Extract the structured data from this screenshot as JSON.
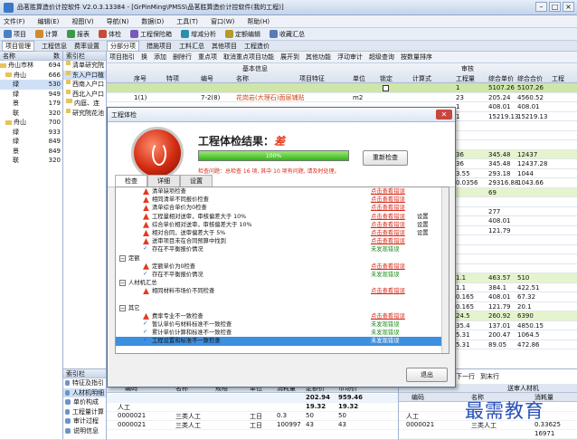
{
  "window": {
    "title": "品茗胜算造价计控软件 V2.0.3.13384 - [GrPinMing\\PMSS\\品茗胜算造价计控软件(我的工程)]"
  },
  "menu": [
    "文件(F)",
    "编辑(E)",
    "视图(V)",
    "导航(N)",
    "数据(D)",
    "工具(T)",
    "窗口(W)",
    "帮助(H)"
  ],
  "toolbar": [
    "项目",
    "计算",
    "报表",
    "体检",
    "工程保险箱",
    "增减分析",
    "定额编辑",
    "收藏汇总"
  ],
  "tabs": [
    "项目管理",
    "工程信息",
    "费率设置",
    "分部分项",
    "措施项目",
    "工料汇总",
    "其他项目",
    "工程造价"
  ],
  "left_tree": {
    "header": [
      "名称",
      "数"
    ],
    "rows": [
      {
        "label": "舟山市林",
        "val": "694"
      },
      {
        "label": "舟山",
        "val": "666"
      },
      {
        "label": "绿",
        "val": "530"
      },
      {
        "label": "绿",
        "val": "949"
      },
      {
        "label": "景",
        "val": "179"
      },
      {
        "label": "联",
        "val": "320"
      },
      {
        "label": "舟山",
        "val": "700"
      },
      {
        "label": "绿",
        "val": "933"
      },
      {
        "label": "绿",
        "val": "849"
      },
      {
        "label": "景",
        "val": "849"
      },
      {
        "label": "联",
        "val": "320"
      }
    ]
  },
  "nav_tree": {
    "header": "索引栏",
    "rows": [
      "清单研究院",
      "东入户口植",
      "西南入户口",
      "西北入户口",
      "内庭、连",
      "研究院花池"
    ]
  },
  "cmdbar": [
    "项目指引",
    "换",
    "添加",
    "删除行",
    "重点项",
    "取消重点项目功能",
    "展开到",
    "其他功能",
    "浮动审计",
    "超级查询",
    "按数量排序"
  ],
  "grid": {
    "header_top": [
      "基本信息",
      "审核"
    ],
    "columns": [
      "序号",
      "特项",
      "编号",
      "名称",
      "项目特征",
      "单位",
      "锁定",
      "计算式",
      "工程量",
      "综合单价",
      "综合合价",
      "工程"
    ],
    "rows": [
      {
        "a": "",
        "b": "",
        "c": "",
        "d": "",
        "e": "",
        "f": "",
        "g": "",
        "h": "",
        "q": "1",
        "p": "5107.26",
        "t": "5107.26",
        "hl": true
      },
      {
        "a": "1(1)",
        "b": "",
        "c": "7-2(8)",
        "d": "花岗岩(大理石)面层铺贴",
        "e": "",
        "f": "m2",
        "g": "",
        "h": "",
        "q": "23",
        "p": "205.24",
        "t": "4560.52",
        "hl": false
      },
      {
        "a": "",
        "b": "",
        "c": "",
        "d": "",
        "e": "",
        "f": "",
        "g": "",
        "h": "",
        "q": "1",
        "p": "408.01",
        "t": "408.01",
        "hl": false
      },
      {
        "a": "",
        "b": "",
        "c": "",
        "d": "",
        "e": "",
        "f": "",
        "g": "",
        "h": "",
        "q": "1",
        "p": "15219.13",
        "t": "15219.13",
        "hl": false
      },
      {
        "a": "",
        "b": "",
        "c": "",
        "d": "",
        "e": "",
        "f": "",
        "g": "",
        "h": "",
        "q": "",
        "p": "",
        "t": "",
        "hl": false
      },
      {
        "a": "",
        "b": "",
        "c": "",
        "d": "",
        "e": "",
        "f": "",
        "g": "",
        "h": "",
        "q": "",
        "p": "",
        "t": "",
        "hl": false
      },
      {
        "a": "",
        "b": "",
        "c": "",
        "d": "",
        "e": "",
        "f": "",
        "g": "",
        "h": "",
        "q": "",
        "p": "",
        "t": "",
        "hl": false
      },
      {
        "a": "",
        "b": "",
        "c": "",
        "d": "",
        "e": "",
        "f": "",
        "g": "",
        "h": "",
        "q": "36",
        "p": "345.48",
        "t": "12437",
        "hl": true
      },
      {
        "a": "",
        "b": "",
        "c": "",
        "d": "",
        "e": "",
        "f": "",
        "g": "",
        "h": "",
        "q": "36",
        "p": "345.48",
        "t": "12437.28",
        "hl": false
      },
      {
        "a": "",
        "b": "",
        "c": "",
        "d": "",
        "e": "",
        "f": "",
        "g": "",
        "h": "",
        "q": "3.55",
        "p": "293.18",
        "t": "1044",
        "hl": false
      },
      {
        "a": "",
        "b": "",
        "c": "",
        "d": "",
        "e": "",
        "f": "",
        "g": "",
        "h": "",
        "q": "0.0356",
        "p": "29316.88",
        "t": "1043.66",
        "hl": false
      },
      {
        "a": "",
        "b": "",
        "c": "",
        "d": "",
        "e": "",
        "f": "",
        "g": "",
        "h": "",
        "q": "",
        "p": "69",
        "t": "",
        "hl": true
      },
      {
        "a": "",
        "b": "",
        "c": "",
        "d": "",
        "e": "",
        "f": "",
        "g": "",
        "h": "",
        "q": "",
        "p": "",
        "t": "",
        "hl": false
      },
      {
        "a": "",
        "b": "",
        "c": "",
        "d": "",
        "e": "",
        "f": "",
        "g": "",
        "h": "",
        "q": "",
        "p": "277",
        "t": "",
        "hl": false
      },
      {
        "a": "",
        "b": "",
        "c": "",
        "d": "",
        "e": "",
        "f": "",
        "g": "",
        "h": "",
        "q": "",
        "p": "408.01",
        "t": "",
        "hl": false
      },
      {
        "a": "",
        "b": "",
        "c": "",
        "d": "",
        "e": "",
        "f": "",
        "g": "",
        "h": "",
        "q": "",
        "p": "121.79",
        "t": "",
        "hl": false
      },
      {
        "a": "",
        "b": "",
        "c": "",
        "d": "",
        "e": "",
        "f": "",
        "g": "",
        "h": "",
        "q": "",
        "p": "",
        "t": "",
        "hl": false
      },
      {
        "a": "",
        "b": "",
        "c": "",
        "d": "",
        "e": "",
        "f": "",
        "g": "",
        "h": "",
        "q": "",
        "p": "",
        "t": "",
        "hl": false
      },
      {
        "a": "",
        "b": "",
        "c": "",
        "d": "",
        "e": "",
        "f": "",
        "g": "",
        "h": "",
        "q": "",
        "p": "",
        "t": "",
        "hl": false
      },
      {
        "a": "",
        "b": "",
        "c": "",
        "d": "",
        "e": "",
        "f": "",
        "g": "",
        "h": "",
        "q": "",
        "p": "",
        "t": "",
        "hl": false
      },
      {
        "a": "",
        "b": "",
        "c": "",
        "d": "",
        "e": "",
        "f": "",
        "g": "",
        "h": "",
        "q": "1.1",
        "p": "463.57",
        "t": "510",
        "hl": true
      },
      {
        "a": "",
        "b": "",
        "c": "",
        "d": "",
        "e": "",
        "f": "",
        "g": "",
        "h": "",
        "q": "1.1",
        "p": "384.1",
        "t": "422.51",
        "hl": false
      },
      {
        "a": "",
        "b": "",
        "c": "",
        "d": "",
        "e": "",
        "f": "",
        "g": "",
        "h": "",
        "q": "0.165",
        "p": "408.01",
        "t": "67.32",
        "hl": false
      },
      {
        "a": "",
        "b": "",
        "c": "",
        "d": "",
        "e": "",
        "f": "",
        "g": "",
        "h": "",
        "q": "0.165",
        "p": "121.79",
        "t": "20.1",
        "hl": false
      },
      {
        "a": "",
        "b": "",
        "c": "",
        "d": "",
        "e": "",
        "f": "",
        "g": "",
        "h": "",
        "q": "24.5",
        "p": "260.92",
        "t": "6390",
        "hl": true
      },
      {
        "a": "",
        "b": "",
        "c": "",
        "d": "",
        "e": "",
        "f": "",
        "g": "",
        "h": "",
        "q": "35.4",
        "p": "137.01",
        "t": "4850.15",
        "hl": false
      },
      {
        "a": "",
        "b": "",
        "c": "",
        "d": "",
        "e": "",
        "f": "",
        "g": "",
        "h": "",
        "q": "5.31",
        "p": "200.47",
        "t": "1064.5",
        "hl": false
      },
      {
        "a": "",
        "b": "",
        "c": "",
        "d": "",
        "e": "",
        "f": "",
        "g": "",
        "h": "",
        "q": "5.31",
        "p": "89.05",
        "t": "472.86",
        "hl": false
      }
    ]
  },
  "bottom_nav": {
    "header": "索引栏",
    "items": [
      "特征及指引",
      "人材机明细",
      "单价构成",
      "工程量计算",
      "审计过程",
      "说明信息"
    ]
  },
  "bottom_table": {
    "columns": [
      "编码",
      "名称",
      "规格",
      "单位",
      "消耗量",
      "定额价",
      "市场价"
    ],
    "rows": [
      {
        "code": "",
        "name": "",
        "spec": "",
        "unit": "",
        "qty": "",
        "std": "202.94",
        "mkt": "959.46"
      },
      {
        "code": "人工",
        "name": "",
        "spec": "",
        "unit": "",
        "qty": "",
        "std": "19.32",
        "mkt": "19.32"
      },
      {
        "code": "0000021",
        "name": "三类人工",
        "spec": "",
        "unit": "工日",
        "qty": "0.3",
        "std": "50",
        "mkt": "50"
      },
      {
        "code": "0000021",
        "name": "三类人工",
        "spec": "",
        "unit": "工日",
        "qty": "100997",
        "std": "43",
        "mkt": "43"
      }
    ]
  },
  "bottom_right": {
    "nav": [
      "到上一行",
      "上一行",
      "下一行",
      "到末行"
    ],
    "header": "送审人材机",
    "columns": [
      "编码",
      "名称",
      "消耗量"
    ],
    "rows": [
      {
        "code": "",
        "name": "",
        "qty": ""
      },
      {
        "code": "人工",
        "name": "",
        "qty": ""
      },
      {
        "code": "0000021",
        "name": "三类人工",
        "qty": "0.33625"
      },
      {
        "code": "",
        "name": "",
        "qty": "16971"
      }
    ]
  },
  "watermark": "最需教育",
  "dialog": {
    "title": "工程体检",
    "result_label": "工程体检结果：",
    "grade": "差",
    "progress_percent": 100,
    "progress_text": "100%",
    "summary": "检查问题：总检查 16 项, 其中 10 项有问题, 请及时处理。",
    "recheck_label": "重新检查",
    "tabs": [
      "检查",
      "详细",
      "设置"
    ],
    "close_label": "退出",
    "items": [
      {
        "kind": "item",
        "text": "清单缺项检查",
        "status": "点击查看错误",
        "extra": "",
        "icon": "warn"
      },
      {
        "kind": "item",
        "text": "相同清单不同报价检查",
        "status": "点击查看错误",
        "extra": "",
        "icon": "warn"
      },
      {
        "kind": "item",
        "text": "清单综合单价为0检查",
        "status": "点击查看错误",
        "extra": "",
        "icon": "warn"
      },
      {
        "kind": "item",
        "text": "工程量相对送审，审核偏差大于 10%",
        "status": "点击查看错误",
        "extra": "设置",
        "icon": "warn"
      },
      {
        "kind": "item",
        "text": "综合单价相对送审，审核偏差大于 10%",
        "status": "点击查看错误",
        "extra": "设置",
        "icon": "warn"
      },
      {
        "kind": "item",
        "text": "相对合同，送审偏差大于 5%",
        "status": "点击查看错误",
        "extra": "设置",
        "icon": "warn"
      },
      {
        "kind": "item",
        "text": "送审项目未在合同预算中找到",
        "status": "点击查看错误",
        "extra": "",
        "icon": "warn"
      },
      {
        "kind": "item",
        "text": "存在不平衡报价情况",
        "status": "未发现错误",
        "extra": "",
        "icon": "ok"
      },
      {
        "kind": "group",
        "text": "定额",
        "status": "",
        "extra": "",
        "icon": "minus"
      },
      {
        "kind": "item",
        "text": "定额单价为0检查",
        "status": "点击查看错误",
        "extra": "",
        "icon": "warn"
      },
      {
        "kind": "item",
        "text": "存在不平衡报价情况",
        "status": "未发现错误",
        "extra": "",
        "icon": "ok"
      },
      {
        "kind": "group",
        "text": "人材机汇总",
        "status": "",
        "extra": "",
        "icon": "minus"
      },
      {
        "kind": "item",
        "text": "相同材料市场价不同检查",
        "status": "点击查看错误",
        "extra": "",
        "icon": "warn"
      },
      {
        "kind": "item",
        "text": "",
        "status": "",
        "extra": "",
        "icon": "none"
      },
      {
        "kind": "group",
        "text": "其它",
        "status": "",
        "extra": "",
        "icon": "minus"
      },
      {
        "kind": "item",
        "text": "费率专业不一致检查",
        "status": "点击查看错误",
        "extra": "",
        "icon": "warn"
      },
      {
        "kind": "item",
        "text": "暂认单价与材料标准不一致检查",
        "status": "未发现错误",
        "extra": "",
        "icon": "ok"
      },
      {
        "kind": "item",
        "text": "累计单价计算和标准不一致检查",
        "status": "未发现错误",
        "extra": "",
        "icon": "ok"
      },
      {
        "kind": "item",
        "text": "工程设置和标准不一致检查",
        "status": "未发现错误",
        "extra": "",
        "icon": "ok",
        "selected": true
      }
    ]
  }
}
